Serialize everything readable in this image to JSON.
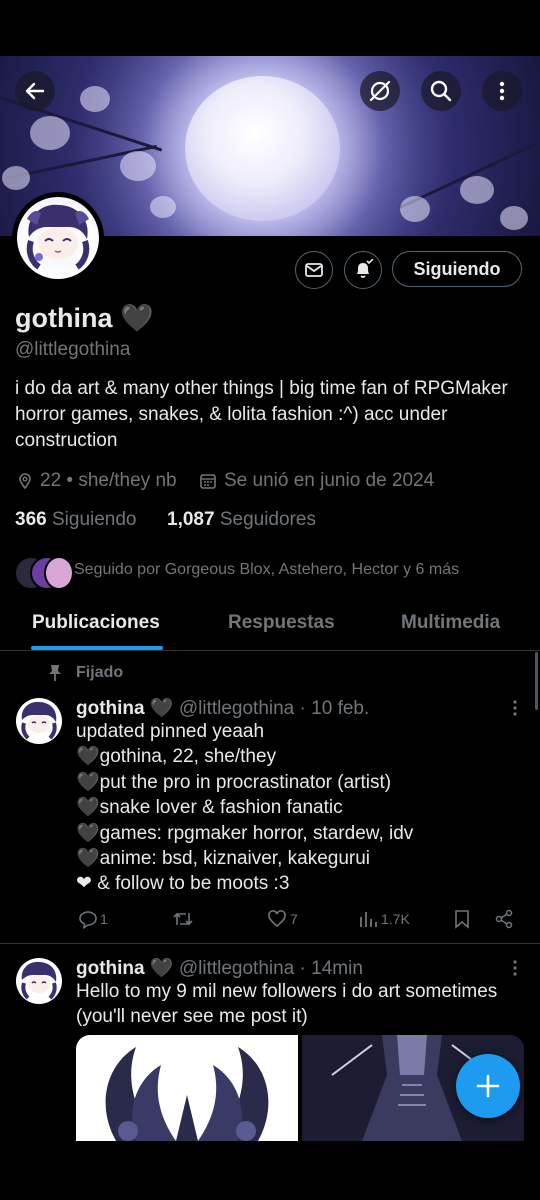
{
  "profile": {
    "name": "gothina",
    "name_emoji": "🖤",
    "handle": "@littlegothina",
    "bio": "i do da art & many other things | big time fan of RPGMaker horror games, snakes, & lolita fashion :^) acc under construction",
    "location": "22 • she/they nb",
    "joined": "Se unió en junio de 2024",
    "following_count": "366",
    "following_label": "Siguiendo",
    "followers_count": "1,087",
    "followers_label": "Seguidores",
    "followed_by": "Seguido por Gorgeous Blox, Astehero, Hector y 6 más",
    "follow_button": "Siguiendo"
  },
  "tabs": [
    {
      "label": "Publicaciones",
      "active": true
    },
    {
      "label": "Respuestas",
      "active": false
    },
    {
      "label": "Multimedia",
      "active": false
    }
  ],
  "pinned_label": "Fijado",
  "posts": [
    {
      "name": "gothina",
      "emoji": "🖤",
      "handle": "@littlegothina",
      "time": "· 10 feb.",
      "lines": [
        "updated pinned yeaah",
        "🖤gothina, 22, she/they",
        "🖤put the pro in procrastinator (artist)",
        "🖤snake lover & fashion fanatic",
        "🖤games: rpgmaker horror, stardew, idv",
        "🖤anime: bsd, kiznaiver, kakegurui",
        " ❤ & follow to be moots :3"
      ],
      "replies": "1",
      "reposts": "",
      "likes": "7",
      "views": "1.7K"
    },
    {
      "name": "gothina",
      "emoji": "🖤",
      "handle": "@littlegothina",
      "time": "· 14min",
      "lines": [
        "Hello to my 9 mil new followers i do art sometimes",
        "(you'll never see me post it)"
      ]
    }
  ],
  "colors": {
    "background": "#000000",
    "text": "#e7e9ea",
    "secondary": "#71767b",
    "accent": "#1d9bf0",
    "border": "#2f3336"
  },
  "icons": [
    "back-arrow-icon",
    "grok-icon",
    "search-icon",
    "more-vertical-icon",
    "mail-icon",
    "bell-icon",
    "location-icon",
    "calendar-icon",
    "pin-icon",
    "reply-icon",
    "repost-icon",
    "like-icon",
    "views-icon",
    "bookmark-icon",
    "share-icon",
    "plus-icon"
  ]
}
